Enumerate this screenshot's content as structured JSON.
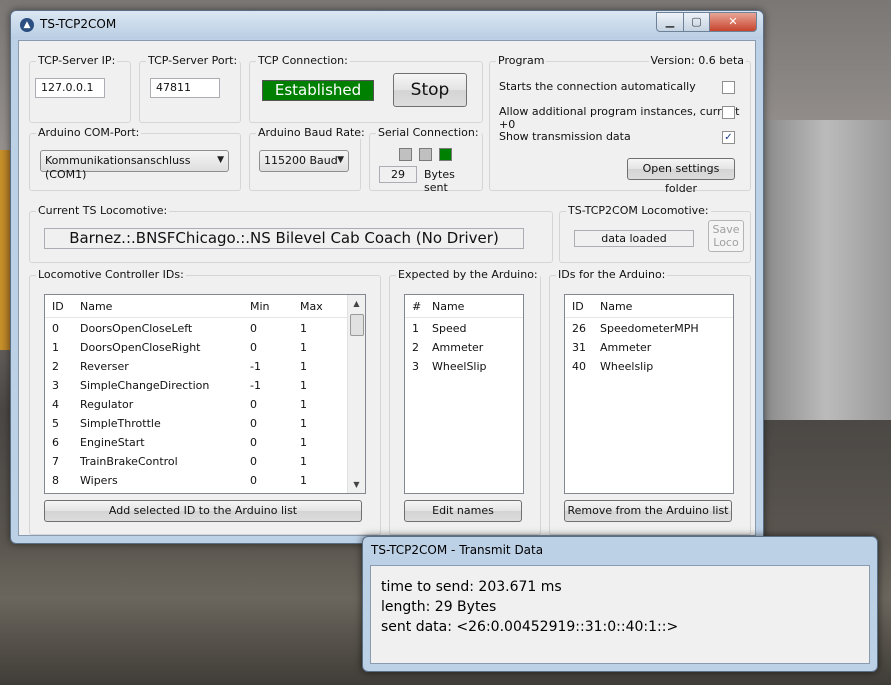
{
  "main_window": {
    "title": "TS-TCP2COM",
    "controls": {
      "minimize": "▁",
      "maximize": "▢",
      "close": "✕"
    }
  },
  "tcp_server_ip": {
    "label": "TCP-Server IP:",
    "value": "127.0.0.1"
  },
  "tcp_server_port": {
    "label": "TCP-Server Port:",
    "value": "47811"
  },
  "tcp_connection": {
    "label": "TCP Connection:",
    "status": "Established",
    "stop_button": "Stop"
  },
  "program": {
    "label": "Program",
    "version": "Version: 0.6 beta",
    "options": [
      {
        "label": "Starts the connection automatically",
        "checked": false
      },
      {
        "label": "Allow additional program instances, current +0",
        "checked": false
      },
      {
        "label": "Show transmission data",
        "checked": true
      }
    ],
    "open_settings_button": "Open settings folder"
  },
  "com_port": {
    "label": "Arduino COM-Port:",
    "value": "Kommunikationsanschluss (COM1)"
  },
  "baud_rate": {
    "label": "Arduino Baud Rate:",
    "value": "115200 Baud"
  },
  "serial_connection": {
    "label": "Serial Connection:",
    "bytes_value": "29",
    "bytes_label": "Bytes sent",
    "colors": {
      "led_off": "#c0c0c0",
      "led_on": "#008000"
    }
  },
  "current_loco": {
    "label": "Current TS Locomotive:",
    "value": "Barnez.:.BNSFChicago.:.NS Bilevel Cab Coach (No Driver)"
  },
  "tcp2com_loco": {
    "label": "TS-TCP2COM Locomotive:",
    "status": "data loaded",
    "save_button": "Save Loco"
  },
  "controller_ids": {
    "label": "Locomotive Controller IDs:",
    "columns": [
      "ID",
      "Name",
      "Min",
      "Max"
    ],
    "rows": [
      [
        "0",
        "DoorsOpenCloseLeft",
        "0",
        "1"
      ],
      [
        "1",
        "DoorsOpenCloseRight",
        "0",
        "1"
      ],
      [
        "2",
        "Reverser",
        "-1",
        "1"
      ],
      [
        "3",
        "SimpleChangeDirection",
        "-1",
        "1"
      ],
      [
        "4",
        "Regulator",
        "0",
        "1"
      ],
      [
        "5",
        "SimpleThrottle",
        "0",
        "1"
      ],
      [
        "6",
        "EngineStart",
        "0",
        "1"
      ],
      [
        "7",
        "TrainBrakeControl",
        "0",
        "1"
      ],
      [
        "8",
        "Wipers",
        "0",
        "1"
      ]
    ],
    "add_button": "Add selected ID to the Arduino list"
  },
  "expected_by_arduino": {
    "label": "Expected by the Arduino:",
    "columns": [
      "#",
      "Name"
    ],
    "rows": [
      [
        "1",
        "Speed"
      ],
      [
        "2",
        "Ammeter"
      ],
      [
        "3",
        "WheelSlip"
      ]
    ],
    "edit_button": "Edit names"
  },
  "ids_for_arduino": {
    "label": "IDs for the Arduino:",
    "columns": [
      "ID",
      "Name"
    ],
    "rows": [
      [
        "26",
        "SpeedometerMPH"
      ],
      [
        "31",
        "Ammeter"
      ],
      [
        "40",
        "Wheelslip"
      ]
    ],
    "remove_button": "Remove from the Arduino list"
  },
  "transmit_window": {
    "title": "TS-TCP2COM - Transmit Data",
    "time_to_send": "time to send: 203.671 ms",
    "length": "length: 29 Bytes",
    "sent_data": "sent data: <26:0.00452919::31:0::40:1::>"
  }
}
